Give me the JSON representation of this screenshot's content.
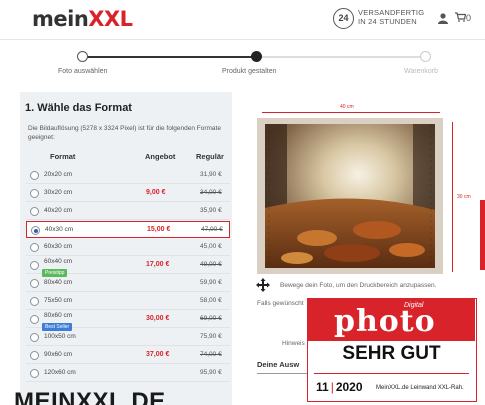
{
  "header": {
    "logo_main": "mein",
    "logo_accent": "XXL",
    "badge_number": "24",
    "shipping_line1": "VERSANDFERTIG",
    "shipping_line2": "IN 24 STUNDEN",
    "cart_count": "0"
  },
  "stepper": {
    "steps": [
      {
        "label": "Foto auswählen",
        "state": "done"
      },
      {
        "label": "Produkt gestalten",
        "state": "active"
      },
      {
        "label": "Warenkorb",
        "state": "todo"
      }
    ]
  },
  "format": {
    "heading": "1. Wähle das Format",
    "intro": "Die Bildauflösung (5278 x 3324 Pixel) ist für die folgenden Formate geeignet:",
    "col_format": "Format",
    "col_offer": "Angebot",
    "col_regular": "Regulär",
    "rows": [
      {
        "format": "20x20 cm",
        "offer": "",
        "regular": "31,90 €",
        "strike": false,
        "selected": false,
        "tag": ""
      },
      {
        "format": "30x20 cm",
        "offer": "9,00 €",
        "regular": "34,00 €",
        "strike": true,
        "selected": false,
        "tag": ""
      },
      {
        "format": "40x20 cm",
        "offer": "",
        "regular": "35,90 €",
        "strike": false,
        "selected": false,
        "tag": ""
      },
      {
        "format": "40x30 cm",
        "offer": "15,00 €",
        "regular": "47,00 €",
        "strike": true,
        "selected": true,
        "tag": ""
      },
      {
        "format": "60x30 cm",
        "offer": "",
        "regular": "45,00 €",
        "strike": false,
        "selected": false,
        "tag": ""
      },
      {
        "format": "60x40 cm",
        "offer": "17,00 €",
        "regular": "49,00 €",
        "strike": true,
        "selected": false,
        "tag": "Preistipp"
      },
      {
        "format": "80x40 cm",
        "offer": "",
        "regular": "59,90 €",
        "strike": false,
        "selected": false,
        "tag": ""
      },
      {
        "format": "75x50 cm",
        "offer": "",
        "regular": "58,00 €",
        "strike": false,
        "selected": false,
        "tag": ""
      },
      {
        "format": "80x60 cm",
        "offer": "30,00 €",
        "regular": "69,00 €",
        "strike": true,
        "selected": false,
        "tag": "Best Seller"
      },
      {
        "format": "100x50 cm",
        "offer": "",
        "regular": "75,90 €",
        "strike": false,
        "selected": false,
        "tag": ""
      },
      {
        "format": "90x60 cm",
        "offer": "37,00 €",
        "regular": "74,00 €",
        "strike": true,
        "selected": false,
        "tag": ""
      },
      {
        "format": "120x60 cm",
        "offer": "",
        "regular": "95,90 €",
        "strike": false,
        "selected": false,
        "tag": ""
      }
    ]
  },
  "preview": {
    "width_label": "40 cm",
    "height_label": "30 cm",
    "move_hint": "Bewege dein Foto, um den Druckbereich anzupassen.",
    "falls": "Falls gewünscht",
    "hinweis": "Hinweis",
    "deine": "Deine Ausw"
  },
  "caption": "MEINXXL.DE",
  "award": {
    "digital": "Digital",
    "brand": "photo",
    "grade": "SEHR GUT",
    "issue_num": "11",
    "issue_year": "2020",
    "product": "MeinXXL.de Leinwand XXL-Rah."
  },
  "colors": {
    "brand_red": "#d8232a",
    "step_done": "#555555",
    "step_active": "#222222",
    "step_todo": "#cccccc",
    "tag_green": "#5cb85c",
    "tag_blue": "#3b7dd8"
  }
}
